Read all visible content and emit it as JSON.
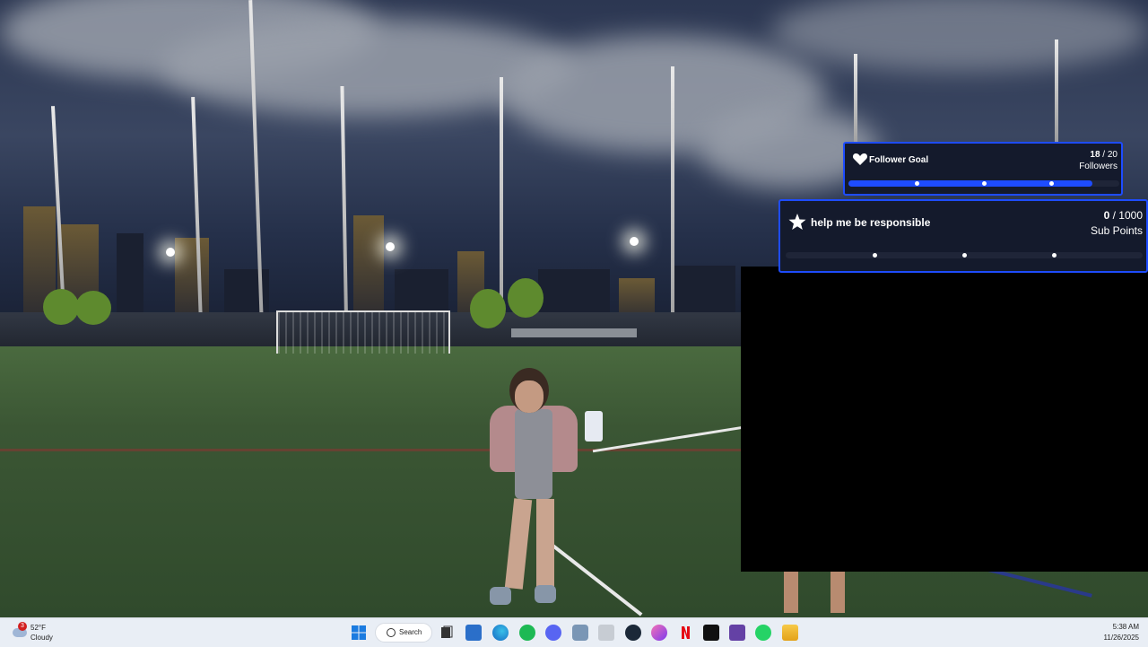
{
  "overlays": {
    "follower_goal": {
      "title": "Follower Goal",
      "current": "18",
      "separator": " / ",
      "target": "20",
      "unit": "Followers",
      "progress": 0.9,
      "icon": "heart-hands-icon",
      "accent": "#1e4cff"
    },
    "sub_goal": {
      "title": "help me be responsible",
      "current": "0",
      "separator": " / ",
      "target": "1000",
      "unit": "Sub Points",
      "progress": 0.0,
      "icon": "star-icon"
    }
  },
  "taskbar": {
    "weather": {
      "temp": "52°F",
      "condition": "Cloudy",
      "badge": "3"
    },
    "search_label": "Search",
    "apps": [
      "windows-start-icon",
      "task-view-icon",
      "microsoft-store-icon",
      "edge-icon",
      "spotify-icon",
      "discord-icon",
      "obs-icon",
      "app-icon",
      "steam-icon",
      "itunes-icon",
      "netflix-icon",
      "capcut-icon",
      "twitch-icon",
      "whatsapp-icon",
      "file-explorer-icon"
    ],
    "time": "5:38 AM",
    "date": "11/26/2025"
  }
}
